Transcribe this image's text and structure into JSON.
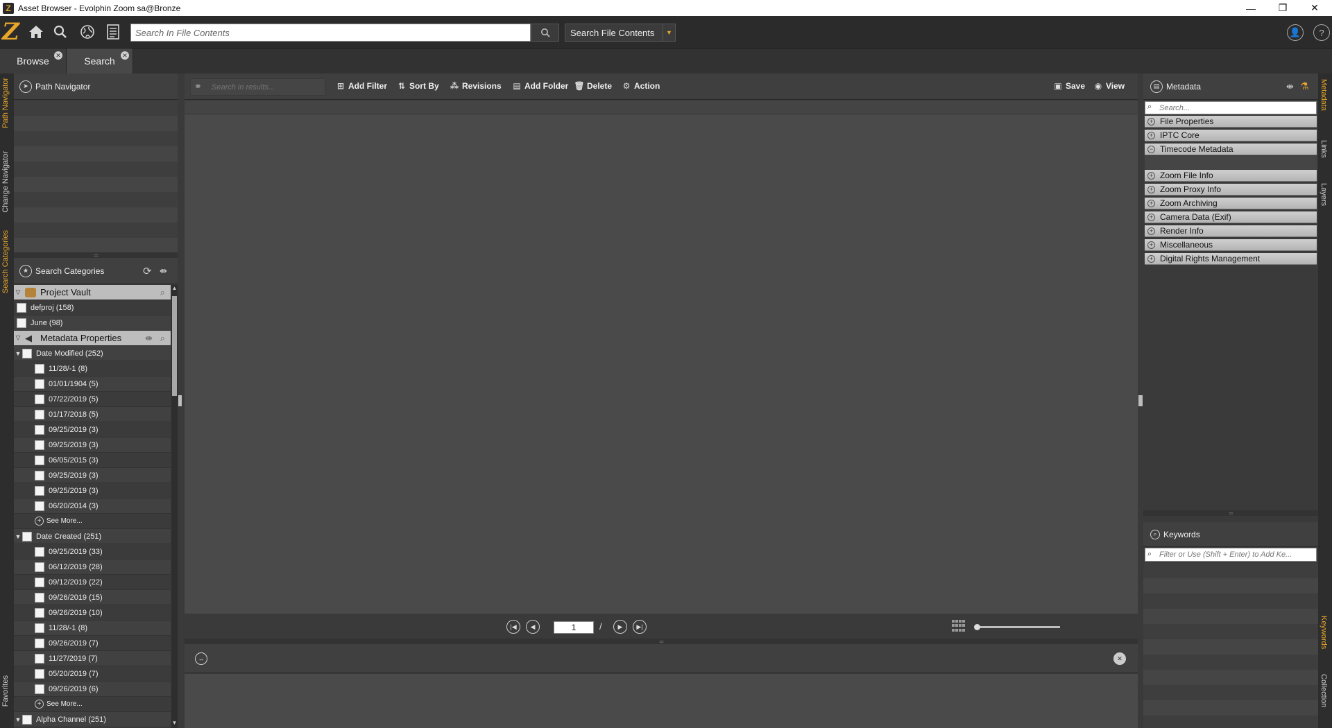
{
  "window": {
    "title": "Asset Browser - Evolphin Zoom sa@Bronze",
    "logo_letter": "Z",
    "minimize": "—",
    "restore": "❐",
    "close": "✕"
  },
  "topbar": {
    "logo": "Z",
    "search_placeholder": "Search In File Contents",
    "search_mode": "Search File Contents"
  },
  "tabs": [
    {
      "label": "Browse"
    },
    {
      "label": "Search"
    }
  ],
  "left_vtabs": [
    "Path Navigator",
    "Change Navigator",
    "Search Categories",
    "Favorites"
  ],
  "right_vtabs": [
    "Metadata",
    "Links",
    "Layers",
    "Keywords",
    "Collection"
  ],
  "path_navigator": {
    "title": "Path Navigator"
  },
  "search_categories": {
    "title": "Search Categories",
    "project_vault": "Project Vault",
    "projects": [
      "defproj (158)",
      "June (98)"
    ],
    "metadata_properties": "Metadata Properties",
    "date_modified": {
      "label": "Date Modified (252)",
      "items": [
        "11/28/-1 (8)",
        "01/01/1904 (5)",
        "07/22/2019 (5)",
        "01/17/2018 (5)",
        "09/25/2019 (3)",
        "09/25/2019 (3)",
        "06/05/2015 (3)",
        "09/25/2019 (3)",
        "09/25/2019 (3)",
        "06/20/2014 (3)"
      ],
      "see_more": "See More..."
    },
    "date_created": {
      "label": "Date Created (251)",
      "items": [
        "09/25/2019 (33)",
        "06/12/2019 (28)",
        "09/12/2019 (22)",
        "09/26/2019 (15)",
        "09/26/2019 (10)",
        "11/28/-1 (8)",
        "09/26/2019 (7)",
        "11/27/2019 (7)",
        "05/20/2019 (7)",
        "09/26/2019 (6)"
      ],
      "see_more": "See More..."
    },
    "alpha_channel": "Alpha Channel (251)"
  },
  "center_toolbar": {
    "results_placeholder": "Search in results...",
    "add_filter": "Add Filter",
    "sort_by": "Sort By",
    "revisions": "Revisions",
    "add_folder": "Add Folder",
    "delete": "Delete",
    "action": "Action",
    "save": "Save",
    "view": "View"
  },
  "pager": {
    "page": "1",
    "separator": "/"
  },
  "metadata": {
    "title": "Metadata",
    "search_placeholder": "Search...",
    "sections": [
      {
        "label": "File Properties",
        "expanded": false
      },
      {
        "label": "IPTC Core",
        "expanded": false
      },
      {
        "label": "Timecode Metadata",
        "expanded": true
      },
      {
        "label": "Zoom File Info",
        "expanded": false
      },
      {
        "label": "Zoom Proxy Info",
        "expanded": false
      },
      {
        "label": "Zoom Archiving",
        "expanded": false
      },
      {
        "label": "Camera Data (Exif)",
        "expanded": false
      },
      {
        "label": "Render Info",
        "expanded": false
      },
      {
        "label": "Miscellaneous",
        "expanded": false
      },
      {
        "label": "Digital Rights Management",
        "expanded": false
      }
    ]
  },
  "keywords": {
    "title": "Keywords",
    "placeholder": "Filter or Use (Shift + Enter) to Add Ke..."
  },
  "colors": {
    "accent": "#e8a62a",
    "panel": "#3a3a3a",
    "toolbar": "#2b2b2b"
  }
}
